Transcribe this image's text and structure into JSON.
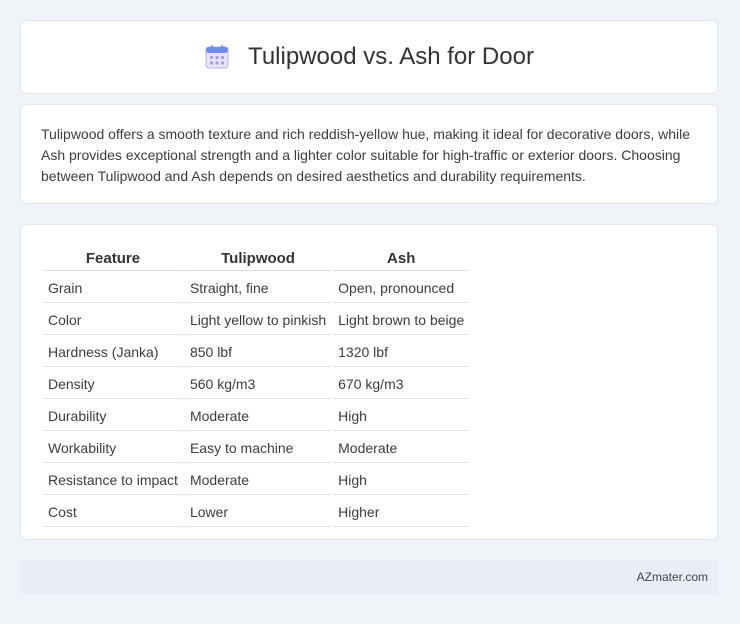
{
  "header": {
    "title": "Tulipwood vs. Ash for Door",
    "icon": "calendar-icon"
  },
  "description": "Tulipwood offers a smooth texture and rich reddish-yellow hue, making it ideal for decorative doors, while Ash provides exceptional strength and a lighter color suitable for high-traffic or exterior doors. Choosing between Tulipwood and Ash depends on desired aesthetics and durability requirements.",
  "table": {
    "headers": [
      "Feature",
      "Tulipwood",
      "Ash"
    ],
    "rows": [
      [
        "Grain",
        "Straight, fine",
        "Open, pronounced"
      ],
      [
        "Color",
        "Light yellow to pinkish",
        "Light brown to beige"
      ],
      [
        "Hardness (Janka)",
        "850 lbf",
        "1320 lbf"
      ],
      [
        "Density",
        "560 kg/m3",
        "670 kg/m3"
      ],
      [
        "Durability",
        "Moderate",
        "High"
      ],
      [
        "Workability",
        "Easy to machine",
        "Moderate"
      ],
      [
        "Resistance to impact",
        "Moderate",
        "High"
      ],
      [
        "Cost",
        "Lower",
        "Higher"
      ]
    ]
  },
  "footer": {
    "brand": "AZmater.com"
  }
}
